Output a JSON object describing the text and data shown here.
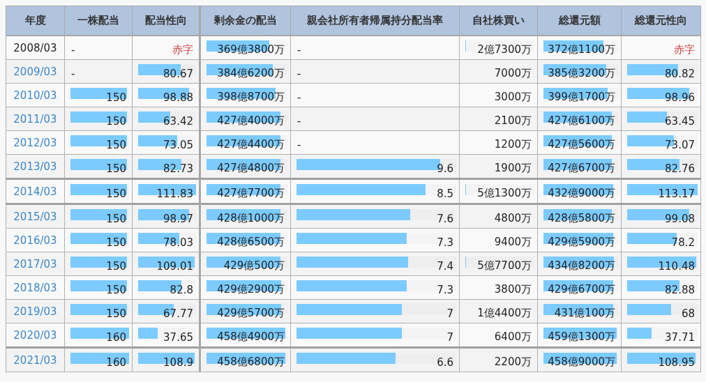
{
  "table": {
    "columns": [
      "年度",
      "一株配当",
      "配当性向",
      "剰余金の配当",
      "親会社所有者帰属持分配当率",
      "自社株買い",
      "総還元額",
      "総還元性向"
    ],
    "rows": [
      {
        "divider_above": false,
        "cells": [
          {
            "kind": "year",
            "text": "2008/03",
            "link": false
          },
          {
            "kind": "dash",
            "text": "-"
          },
          {
            "kind": "deficit",
            "text": "赤字"
          },
          {
            "kind": "number",
            "text": "369億3800万",
            "level": 0.78
          },
          {
            "kind": "dash",
            "text": "-"
          },
          {
            "kind": "number",
            "text": "2億7300万",
            "level": 0.01
          },
          {
            "kind": "number",
            "text": "372億1100万",
            "level": 0.8
          },
          {
            "kind": "deficit",
            "text": "赤字"
          }
        ]
      },
      {
        "divider_above": false,
        "cells": [
          {
            "kind": "year",
            "text": "2009/03",
            "link": true
          },
          {
            "kind": "dash",
            "text": "-"
          },
          {
            "kind": "number",
            "text": "80.67",
            "level": 0.73
          },
          {
            "kind": "number",
            "text": "384億6200万",
            "level": 0.82
          },
          {
            "kind": "dash",
            "text": "-"
          },
          {
            "kind": "number",
            "text": "7000万"
          },
          {
            "kind": "number",
            "text": "385億3200万",
            "level": 0.84
          },
          {
            "kind": "number",
            "text": "80.82",
            "level": 0.72
          }
        ]
      },
      {
        "divider_above": false,
        "cells": [
          {
            "kind": "year",
            "text": "2010/03",
            "link": true
          },
          {
            "kind": "number",
            "text": "150",
            "level": 0.96
          },
          {
            "kind": "number",
            "text": "98.88",
            "level": 0.88
          },
          {
            "kind": "number",
            "text": "398億8700万",
            "level": 0.85
          },
          {
            "kind": "dash",
            "text": "-"
          },
          {
            "kind": "number",
            "text": "3000万"
          },
          {
            "kind": "number",
            "text": "399億1700万",
            "level": 0.86
          },
          {
            "kind": "number",
            "text": "98.96",
            "level": 0.88
          }
        ]
      },
      {
        "divider_above": false,
        "cells": [
          {
            "kind": "year",
            "text": "2011/03",
            "link": true
          },
          {
            "kind": "number",
            "text": "150",
            "level": 0.96
          },
          {
            "kind": "number",
            "text": "63.42",
            "level": 0.56
          },
          {
            "kind": "number",
            "text": "427億4000万",
            "level": 0.91
          },
          {
            "kind": "dash",
            "text": "-"
          },
          {
            "kind": "number",
            "text": "2100万"
          },
          {
            "kind": "number",
            "text": "427億6100万",
            "level": 0.92
          },
          {
            "kind": "number",
            "text": "63.45",
            "level": 0.56
          }
        ]
      },
      {
        "divider_above": false,
        "cells": [
          {
            "kind": "year",
            "text": "2012/03",
            "link": true
          },
          {
            "kind": "number",
            "text": "150",
            "level": 0.96
          },
          {
            "kind": "number",
            "text": "73.05",
            "level": 0.67
          },
          {
            "kind": "number",
            "text": "427億4400万",
            "level": 0.91
          },
          {
            "kind": "dash",
            "text": "-"
          },
          {
            "kind": "number",
            "text": "1200万"
          },
          {
            "kind": "number",
            "text": "427億5600万",
            "level": 0.92
          },
          {
            "kind": "number",
            "text": "73.07",
            "level": 0.66
          }
        ]
      },
      {
        "divider_above": false,
        "cells": [
          {
            "kind": "year",
            "text": "2013/03",
            "link": true
          },
          {
            "kind": "number",
            "text": "150",
            "level": 0.96
          },
          {
            "kind": "number",
            "text": "82.73",
            "level": 0.75
          },
          {
            "kind": "number",
            "text": "427億4800万",
            "level": 0.91
          },
          {
            "kind": "number",
            "text": "9.6",
            "level": 0.9
          },
          {
            "kind": "number",
            "text": "1900万"
          },
          {
            "kind": "number",
            "text": "427億6700万",
            "level": 0.92
          },
          {
            "kind": "number",
            "text": "82.76",
            "level": 0.74
          }
        ]
      },
      {
        "divider_above": true,
        "cells": [
          {
            "kind": "year",
            "text": "2014/03",
            "link": true
          },
          {
            "kind": "number",
            "text": "150",
            "level": 0.96
          },
          {
            "kind": "number",
            "text": "111.83",
            "level": 1.0
          },
          {
            "kind": "number",
            "text": "427億7700万",
            "level": 0.91
          },
          {
            "kind": "number",
            "text": "8.5",
            "level": 0.81
          },
          {
            "kind": "number",
            "text": "5億1300万",
            "level": 0.01
          },
          {
            "kind": "number",
            "text": "432億9000万",
            "level": 0.93
          },
          {
            "kind": "number",
            "text": "113.17",
            "level": 1.0
          }
        ]
      },
      {
        "divider_above": true,
        "cells": [
          {
            "kind": "year",
            "text": "2015/03",
            "link": true
          },
          {
            "kind": "number",
            "text": "150",
            "level": 0.96
          },
          {
            "kind": "number",
            "text": "98.97",
            "level": 0.88
          },
          {
            "kind": "number",
            "text": "428億1000万",
            "level": 0.91
          },
          {
            "kind": "number",
            "text": "7.6",
            "level": 0.71
          },
          {
            "kind": "number",
            "text": "4800万"
          },
          {
            "kind": "number",
            "text": "428億5800万",
            "level": 0.92
          },
          {
            "kind": "number",
            "text": "99.08",
            "level": 0.88
          }
        ]
      },
      {
        "divider_above": false,
        "cells": [
          {
            "kind": "year",
            "text": "2016/03",
            "link": true
          },
          {
            "kind": "number",
            "text": "150",
            "level": 0.96
          },
          {
            "kind": "number",
            "text": "78.03",
            "level": 0.71
          },
          {
            "kind": "number",
            "text": "428億6500万",
            "level": 0.91
          },
          {
            "kind": "number",
            "text": "7.3",
            "level": 0.69
          },
          {
            "kind": "number",
            "text": "9400万"
          },
          {
            "kind": "number",
            "text": "429億5900万",
            "level": 0.93
          },
          {
            "kind": "number",
            "text": "78.2",
            "level": 0.7
          }
        ]
      },
      {
        "divider_above": false,
        "cells": [
          {
            "kind": "year",
            "text": "2017/03",
            "link": true
          },
          {
            "kind": "number",
            "text": "150",
            "level": 0.96
          },
          {
            "kind": "number",
            "text": "109.01",
            "level": 0.98
          },
          {
            "kind": "number",
            "text": "429億500万",
            "level": 0.91
          },
          {
            "kind": "number",
            "text": "7.4",
            "level": 0.7
          },
          {
            "kind": "number",
            "text": "5億7700万",
            "level": 0.01
          },
          {
            "kind": "number",
            "text": "434億8200万",
            "level": 0.94
          },
          {
            "kind": "number",
            "text": "110.48",
            "level": 0.98
          }
        ]
      },
      {
        "divider_above": false,
        "cells": [
          {
            "kind": "year",
            "text": "2018/03",
            "link": true
          },
          {
            "kind": "number",
            "text": "150",
            "level": 0.96
          },
          {
            "kind": "number",
            "text": "82.8",
            "level": 0.75
          },
          {
            "kind": "number",
            "text": "429億2900万",
            "level": 0.92
          },
          {
            "kind": "number",
            "text": "7.3",
            "level": 0.69
          },
          {
            "kind": "number",
            "text": "3800万"
          },
          {
            "kind": "number",
            "text": "429億6700万",
            "level": 0.93
          },
          {
            "kind": "number",
            "text": "82.88",
            "level": 0.74
          }
        ]
      },
      {
        "divider_above": false,
        "cells": [
          {
            "kind": "year",
            "text": "2019/03",
            "link": true
          },
          {
            "kind": "number",
            "text": "150",
            "level": 0.96
          },
          {
            "kind": "number",
            "text": "67.77",
            "level": 0.61
          },
          {
            "kind": "number",
            "text": "429億5700万",
            "level": 0.92
          },
          {
            "kind": "number",
            "text": "7",
            "level": 0.66
          },
          {
            "kind": "number",
            "text": "1億4400万"
          },
          {
            "kind": "number",
            "text": "431億100万",
            "level": 0.93
          },
          {
            "kind": "number",
            "text": "68",
            "level": 0.62
          }
        ]
      },
      {
        "divider_above": false,
        "cells": [
          {
            "kind": "year",
            "text": "2020/03",
            "link": true
          },
          {
            "kind": "number",
            "text": "160",
            "level": 1.0
          },
          {
            "kind": "number",
            "text": "37.65",
            "level": 0.34
          },
          {
            "kind": "number",
            "text": "458億4900万",
            "level": 0.97
          },
          {
            "kind": "number",
            "text": "7",
            "level": 0.66
          },
          {
            "kind": "number",
            "text": "6400万"
          },
          {
            "kind": "number",
            "text": "459億1300万",
            "level": 0.98
          },
          {
            "kind": "number",
            "text": "37.71",
            "level": 0.35
          }
        ]
      },
      {
        "divider_above": true,
        "cells": [
          {
            "kind": "year",
            "text": "2021/03",
            "link": true
          },
          {
            "kind": "number",
            "text": "160",
            "level": 1.0
          },
          {
            "kind": "number",
            "text": "108.9",
            "level": 0.98
          },
          {
            "kind": "number",
            "text": "458億6800万",
            "level": 0.97
          },
          {
            "kind": "number",
            "text": "6.6",
            "level": 0.62
          },
          {
            "kind": "number",
            "text": "2200万"
          },
          {
            "kind": "number",
            "text": "458億9000万",
            "level": 0.98
          },
          {
            "kind": "number",
            "text": "108.95",
            "level": 0.97
          }
        ]
      }
    ]
  }
}
